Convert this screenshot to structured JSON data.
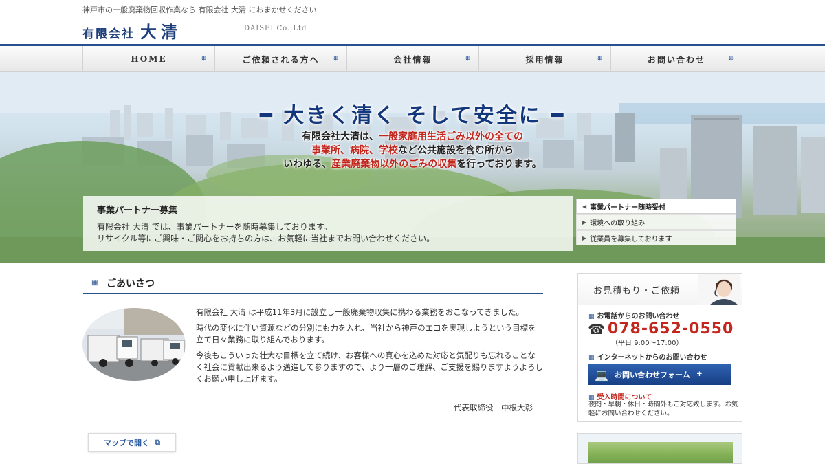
{
  "header": {
    "tagline": "神戸市の一般廃棄物回収作業なら 有限会社 大清 におまかせください",
    "logo_prefix": "有限会社",
    "logo_name": "大清",
    "logo_en": "DAISEI Co.,Ltd"
  },
  "nav": {
    "items": [
      {
        "label": "HOME"
      },
      {
        "label": "ご依頼される方へ"
      },
      {
        "label": "会社情報"
      },
      {
        "label": "採用情報"
      },
      {
        "label": "お問い合わせ"
      }
    ],
    "arrow": "⁜"
  },
  "hero": {
    "title": "━ 大きく清く そして安全に ━",
    "line1_a": "有限会社大清は、",
    "line1_b": "一般家庭用生活ごみ以外の全ての",
    "line2_a": "事業所、病院、学校",
    "line2_b": "など公共施設を含む所から",
    "line3_a": "いわゆる、",
    "line3_b": "産業廃棄物以外のごみの収集",
    "line3_c": "を行っております。",
    "partner_title": "事業パートナー募集",
    "partner_line1": "有限会社 大清 では、事業パートナーを随時募集しております。",
    "partner_line2": "リサイクル等にご興味・ご関心をお持ちの方は、お気軽に当社までお問い合わせください。",
    "links": [
      {
        "label": "事業パートナー随時受付",
        "active": true
      },
      {
        "label": "環境への取り組み",
        "active": false
      },
      {
        "label": "従業員を募集しております",
        "active": false
      }
    ]
  },
  "greeting": {
    "title": "ごあいさつ",
    "p1": "有限会社 大清 は平成11年3月に設立し一般廃棄物収集に携わる業務をおこなってきました。",
    "p2": "時代の変化に伴い資源などの分別にも力を入れ、当社から神戸のエコを実現しようという目標を立て日々業務に取り組んでおります。",
    "p3": "今後もこういった壮大な目標を立て続け、お客様への真心を込めた対応と気配りも忘れることなく社会に貢献出来るよう邁進して参りますので、より一層のご理解、ご支援を賜りますようよろしくお願い申し上げます。",
    "signature": "代表取締役　中根大彰",
    "map_button": "マップで開く"
  },
  "sidebar": {
    "title": "お見積もり・ご依頼",
    "phone_heading": "お電話からのお問い合わせ",
    "phone": "078-652-0550",
    "hours": "（平日 9:00～17:00）",
    "net_heading": "インターネットからのお問い合わせ",
    "form_button": "お問い合わせフォーム",
    "recv_title": "受入時間について",
    "recv_text": "夜間・早朝・休日・時間外もご対応致します。お気軽にお問い合わせください。"
  },
  "colors": {
    "brand_blue": "#27508f",
    "accent_red": "#c3261d"
  }
}
